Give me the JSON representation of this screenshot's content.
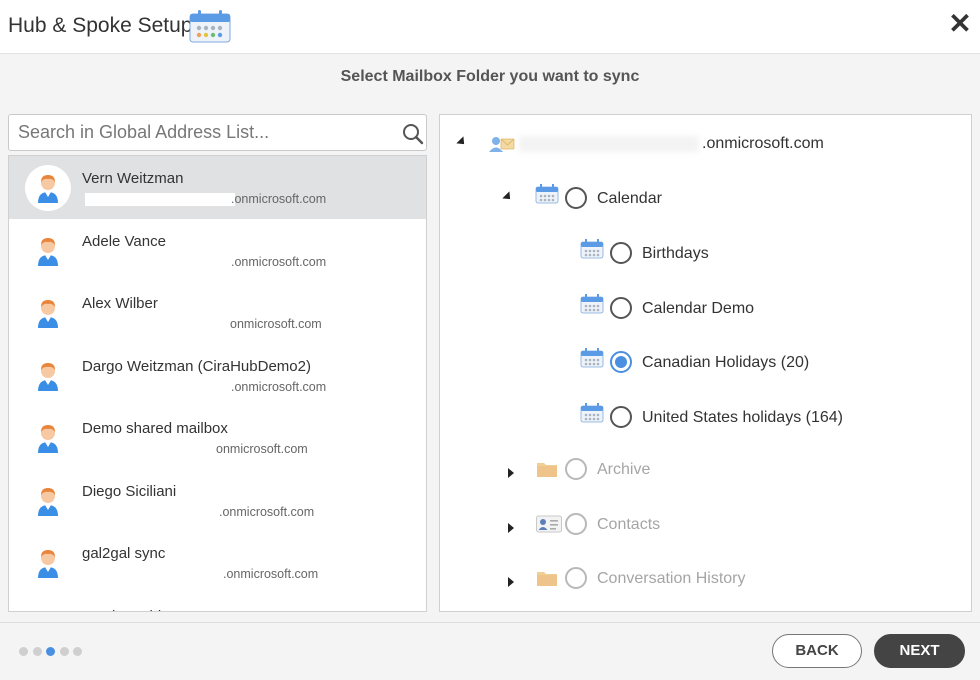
{
  "header": {
    "title": "Hub & Spoke Setup",
    "title_icon": "calendar-icon",
    "close_icon": "close-icon",
    "close_glyph": "✕"
  },
  "subtitle": "Select Mailbox Folder you want to sync",
  "search": {
    "placeholder": "Search in Global Address List...",
    "value": ""
  },
  "contacts": [
    {
      "name": "Vern Weitzman",
      "email": ".onmicrosoft.com",
      "selected": true
    },
    {
      "name": "Adele Vance",
      "email": ".onmicrosoft.com"
    },
    {
      "name": "Alex Wilber",
      "email": "onmicrosoft.com"
    },
    {
      "name": "Dargo Weitzman (CiraHubDemo2)",
      "email": ".onmicrosoft.com"
    },
    {
      "name": "Demo shared mailbox",
      "email": "onmicrosoft.com"
    },
    {
      "name": "Diego Siciliani",
      "email": ".onmicrosoft.com"
    },
    {
      "name": "gal2gal sync",
      "email": ".onmicrosoft.com"
    },
    {
      "name": "Gerda Archie",
      "email": ""
    }
  ],
  "tree": {
    "root": {
      "label": ".onmicrosoft.com",
      "icon": "mailbox-user-icon",
      "expanded": true
    },
    "calendar": {
      "label": "Calendar",
      "icon": "calendar-icon",
      "expanded": true
    },
    "calendar_children": [
      {
        "label": "Birthdays",
        "checked": false
      },
      {
        "label": "Calendar Demo",
        "checked": false
      },
      {
        "label": "Canadian Holidays (20)",
        "checked": true
      },
      {
        "label": "United States holidays (164)",
        "checked": false
      }
    ],
    "others": [
      {
        "label": "Archive",
        "icon": "folder-icon"
      },
      {
        "label": "Contacts",
        "icon": "contact-card-icon"
      },
      {
        "label": "Conversation History",
        "icon": "folder-icon"
      }
    ]
  },
  "footer": {
    "steps": 5,
    "active_step": 3,
    "back_label": "BACK",
    "next_label": "NEXT"
  },
  "colors": {
    "accent": "#4a8fe0",
    "selected_row": "#e0e1e3",
    "next_button": "#444444"
  }
}
